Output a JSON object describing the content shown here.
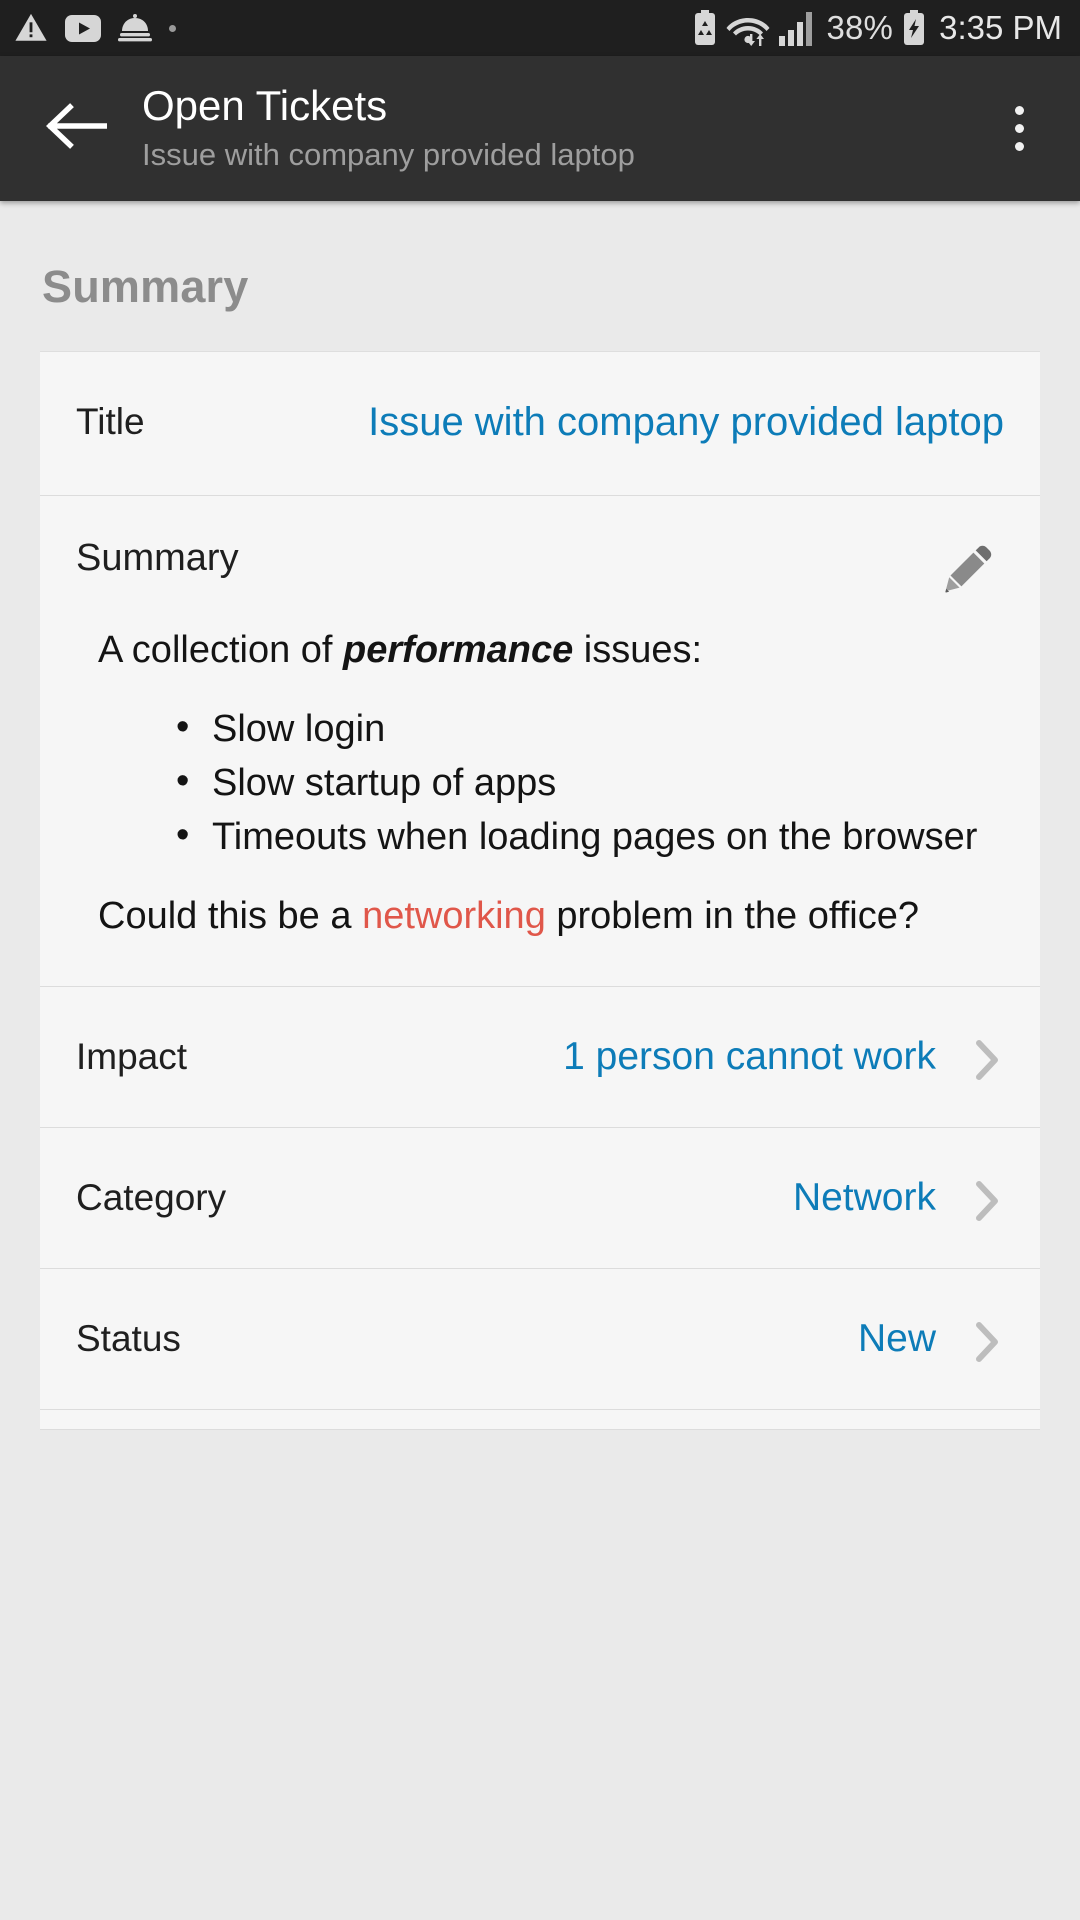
{
  "statusbar": {
    "left_icons": [
      "warning-triangle-icon",
      "youtube-icon",
      "service-bell-icon",
      "small-dot-icon"
    ],
    "battery_saver_icon": "battery-saver-icon",
    "wifi_icon": "wifi-icon",
    "signal_icon": "signal-bars-icon",
    "battery_percent": "38%",
    "charging_icon": "battery-charging-icon",
    "time": "3:35 PM"
  },
  "appbar": {
    "back_icon": "back-arrow-icon",
    "title": "Open Tickets",
    "subtitle": "Issue with company provided laptop",
    "overflow_icon": "overflow-menu-icon"
  },
  "section": {
    "header": "Summary"
  },
  "fields": {
    "title": {
      "label": "Title",
      "value": "Issue with company provided laptop"
    },
    "summary": {
      "label": "Summary",
      "edit_icon": "pencil-edit-icon",
      "intro_before": "A collection of ",
      "intro_emphasis": "performance",
      "intro_after": " issues:",
      "bullets": [
        "Slow login",
        "Slow startup of apps",
        "Timeouts when loading pages on the browser"
      ],
      "outro_before": "Could this be a ",
      "outro_highlight": "networking",
      "outro_after": " problem in the office?"
    },
    "impact": {
      "label": "Impact",
      "value": "1 person cannot work",
      "chevron": "chevron-right-icon"
    },
    "category": {
      "label": "Category",
      "value": "Network",
      "chevron": "chevron-right-icon"
    },
    "status": {
      "label": "Status",
      "value": "New",
      "chevron": "chevron-right-icon"
    }
  },
  "colors": {
    "link_blue": "#0d7cb8",
    "highlight_red": "#e0574a",
    "statusbar_bg": "#1f1f1f",
    "appbar_bg": "#303030",
    "page_bg": "#eaeaea",
    "card_bg": "#f6f6f6"
  }
}
